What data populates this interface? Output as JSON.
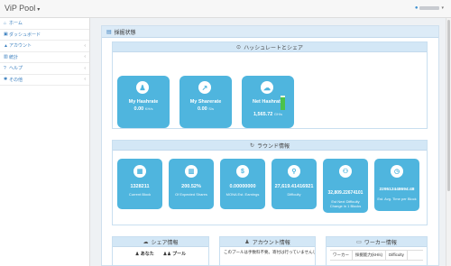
{
  "app": {
    "brand": "ViP Pool",
    "user_name": ""
  },
  "sidebar": {
    "items": [
      {
        "label": "ホーム",
        "icon": "home-icon",
        "has_children": false
      },
      {
        "label": "ダッシュボード",
        "icon": "dashboard-icon",
        "has_children": false
      },
      {
        "label": "アカウント",
        "icon": "user-icon",
        "has_children": true
      },
      {
        "label": "統計",
        "icon": "chart-icon",
        "has_children": true
      },
      {
        "label": "ヘルプ",
        "icon": "question-icon",
        "has_children": true
      },
      {
        "label": "その他",
        "icon": "gear-icon",
        "has_children": true
      }
    ]
  },
  "panel": {
    "title": "採掘状態"
  },
  "hashrate_section": {
    "title": "ハッシュレートとシェア",
    "tiles": [
      {
        "label": "My Hashrate",
        "value": "0.00",
        "unit": "KH/s"
      },
      {
        "label": "My Sharerate",
        "value": "0.00",
        "unit": "S/s"
      },
      {
        "label": "Net Hashrate",
        "value": "1,565.72",
        "unit": "GH/s",
        "level": 0.85
      }
    ]
  },
  "round_section": {
    "title": "ラウンド情報",
    "tiles": [
      {
        "value": "1328211",
        "caption": "Current Block",
        "icon": "grid-icon"
      },
      {
        "value": "200.52%",
        "caption": "Of Expected Shares",
        "icon": "bar-chart-icon"
      },
      {
        "value": "0.00000000",
        "caption": "MONA Est. Earnings",
        "icon": "money-icon"
      },
      {
        "value": "27,619.41416921",
        "caption": "Difficulty",
        "icon": "map-marker-icon"
      },
      {
        "value": "32,809.22674101",
        "caption": "Est Next Difficulty Change in 1 Blocks",
        "icon": "sitemap-icon"
      },
      {
        "value": "229512448694:48",
        "caption": "Est. Avg. Time per Block",
        "icon": "clock-icon"
      }
    ]
  },
  "share_card": {
    "title": "シェア情報",
    "tabs": [
      "あなた",
      "プール"
    ]
  },
  "account_card": {
    "title": "アカウント情報",
    "notice": "このプールは手数料不要。寄付は行っていませんし"
  },
  "worker_card": {
    "title": "ワーカー情報",
    "columns": [
      "ワーカー",
      "採掘能力(kH/s)",
      "Difficulty"
    ]
  },
  "colors": {
    "tile": "#4fb5de",
    "header": "#d3e7f6",
    "link": "#3a7fbf"
  }
}
